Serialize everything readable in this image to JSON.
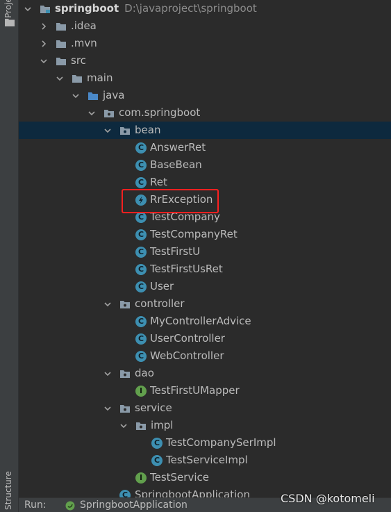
{
  "tool_window": {
    "project_tab_label": "Project",
    "structure_tab_label": "Structure"
  },
  "tree": [
    {
      "label": "springboot",
      "hint": "D:\\javaproject\\springboot",
      "type": "module",
      "expanded": true
    },
    {
      "label": ".idea",
      "type": "folder",
      "expanded": false
    },
    {
      "label": ".mvn",
      "type": "folder",
      "expanded": false
    },
    {
      "label": "src",
      "type": "folder",
      "expanded": true
    },
    {
      "label": "main",
      "type": "folder",
      "expanded": true
    },
    {
      "label": "java",
      "type": "source-folder",
      "expanded": true
    },
    {
      "label": "com.springboot",
      "type": "package",
      "expanded": true
    },
    {
      "label": "bean",
      "type": "package",
      "expanded": true,
      "selected": true
    },
    {
      "label": "AnswerRet",
      "type": "class"
    },
    {
      "label": "BaseBean",
      "type": "class"
    },
    {
      "label": "Ret",
      "type": "class"
    },
    {
      "label": "RrException",
      "type": "exception"
    },
    {
      "label": "TestCompany",
      "type": "class"
    },
    {
      "label": "TestCompanyRet",
      "type": "class"
    },
    {
      "label": "TestFirstU",
      "type": "class"
    },
    {
      "label": "TestFirstUsRet",
      "type": "class"
    },
    {
      "label": "User",
      "type": "class"
    },
    {
      "label": "controller",
      "type": "package",
      "expanded": true
    },
    {
      "label": "MyControllerAdvice",
      "type": "class"
    },
    {
      "label": "UserController",
      "type": "class"
    },
    {
      "label": "WebController",
      "type": "class"
    },
    {
      "label": "dao",
      "type": "package",
      "expanded": true
    },
    {
      "label": "TestFirstUMapper",
      "type": "interface"
    },
    {
      "label": "service",
      "type": "package",
      "expanded": true
    },
    {
      "label": "impl",
      "type": "package",
      "expanded": true
    },
    {
      "label": "TestCompanySerImpl",
      "type": "class"
    },
    {
      "label": "TestServiceImpl",
      "type": "class"
    },
    {
      "label": "TestService",
      "type": "interface"
    },
    {
      "label": "SpringbootApplication",
      "type": "class"
    }
  ],
  "run_bar": {
    "label": "Run:",
    "config": "SpringbootApplication"
  },
  "watermark": "CSDN @kotomeli",
  "colors": {
    "background": "#2b2b2b",
    "selection": "#0d293e",
    "class_icon": "#3d8fb1",
    "interface_icon": "#62a04d",
    "highlight_box": "#ff2020"
  }
}
